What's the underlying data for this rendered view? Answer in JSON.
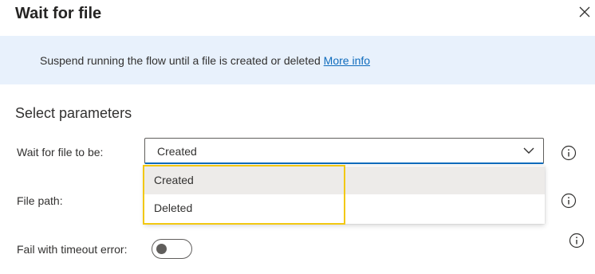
{
  "dialog": {
    "title": "Wait for file",
    "close_icon": "close-icon"
  },
  "banner": {
    "text": "Suspend running the flow until a file is created or deleted",
    "link": "More info"
  },
  "section": {
    "title": "Select parameters"
  },
  "params": {
    "wait_for": {
      "label": "Wait for file to be:",
      "value": "Created",
      "options": [
        "Created",
        "Deleted"
      ]
    },
    "file_path": {
      "label": "File path:"
    },
    "timeout": {
      "label": "Fail with timeout error:",
      "toggle_on": false
    }
  },
  "colors": {
    "accent": "#0f6cbd",
    "banner_bg": "#e8f1fc",
    "highlight": "#f2c811",
    "hover": "#edebe9"
  }
}
